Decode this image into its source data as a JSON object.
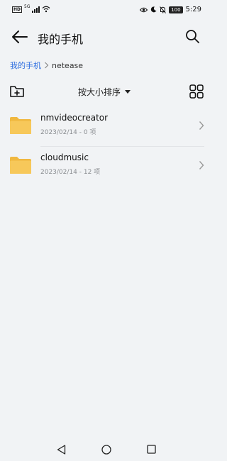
{
  "status": {
    "hd": "HD",
    "network": "5G",
    "battery": "100",
    "time": "5:29"
  },
  "header": {
    "title": "我的手机"
  },
  "breadcrumb": {
    "root": "我的手机",
    "current": "netease"
  },
  "toolbar": {
    "sort_label": "按大小排序"
  },
  "files": [
    {
      "name": "nmvideocreator",
      "meta": "2023/02/14 - 0 项",
      "icon": "folder-icon"
    },
    {
      "name": "cloudmusic",
      "meta": "2023/02/14 - 12 项",
      "icon": "folder-icon"
    }
  ],
  "colors": {
    "accent": "#2f6fe0",
    "folder": "#f7c85a",
    "background": "#f1f3f5"
  }
}
